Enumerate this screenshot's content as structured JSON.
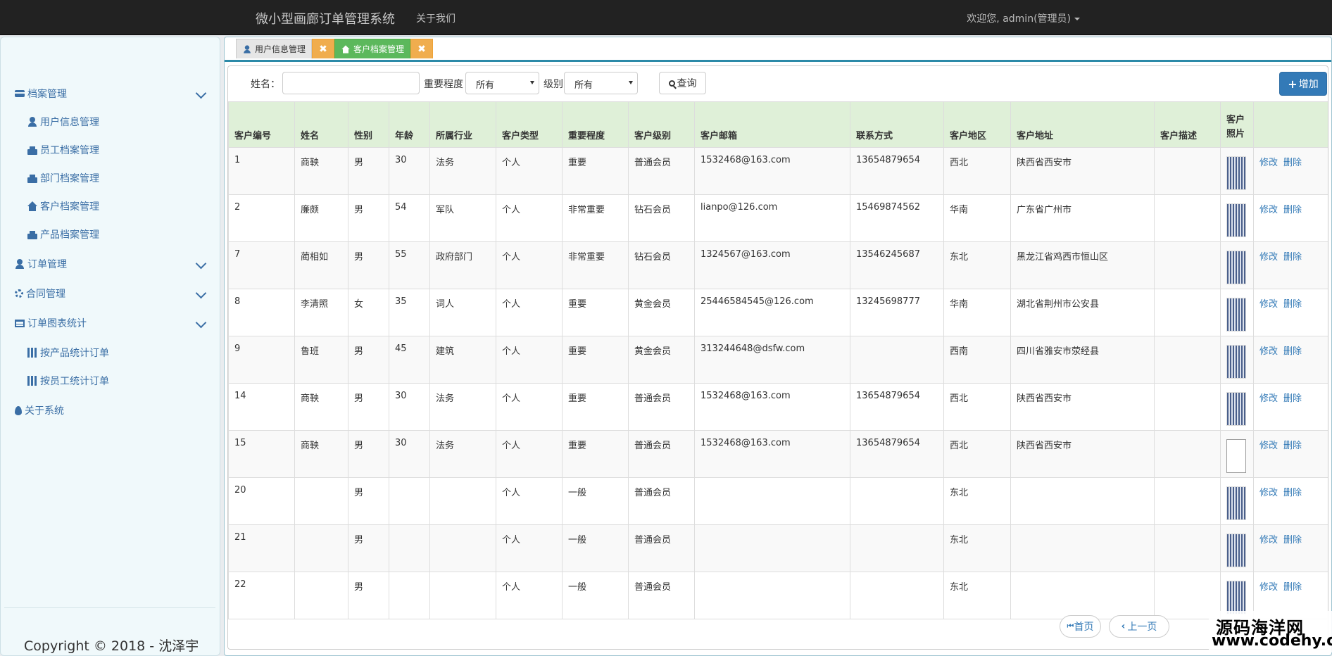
{
  "navbar": {
    "brand": "微小型画廊订单管理系统",
    "about": "关于我们",
    "welcome": "欢迎您, admin(管理员)"
  },
  "sidebar": {
    "groups": [
      {
        "label": "档案管理",
        "icon": "id-card-icon"
      },
      {
        "label": "订单管理",
        "icon": "user-icon"
      },
      {
        "label": "合同管理",
        "icon": "gear-icon"
      },
      {
        "label": "订单图表统计",
        "icon": "table-icon"
      }
    ],
    "items": [
      {
        "label": "用户信息管理",
        "icon": "user-icon"
      },
      {
        "label": "员工档案管理",
        "icon": "print-icon"
      },
      {
        "label": "部门档案管理",
        "icon": "print-icon"
      },
      {
        "label": "客户档案管理",
        "icon": "home-icon"
      },
      {
        "label": "产品档案管理",
        "icon": "print-icon"
      },
      {
        "label": "按产品统计订单",
        "icon": "bar-chart-icon"
      },
      {
        "label": "按员工统计订单",
        "icon": "bar-chart-icon"
      }
    ],
    "about": "关于系统",
    "copyright": "Copyright © 2018 - 沈泽宇"
  },
  "tabs": [
    {
      "label": "用户信息管理",
      "close": "✖"
    },
    {
      "label": "客户档案管理",
      "close": "✖"
    }
  ],
  "search": {
    "name_label": "姓名：",
    "name_value": "",
    "importance_label": "重要程度",
    "importance_value": "所有",
    "level_label": "级别",
    "level_value": "所有",
    "query_button": "查询",
    "add_button": "增加"
  },
  "table": {
    "headers": [
      "客户编号",
      "姓名",
      "性别",
      "年龄",
      "所属行业",
      "客户类型",
      "重要程度",
      "客户级别",
      "客户邮箱",
      "联系方式",
      "客户地区",
      "客户地址",
      "客户描述",
      "客户照片",
      ""
    ],
    "edit_label": "修改",
    "delete_label": "删除",
    "rows": [
      [
        "1",
        "商鞅",
        "男",
        "30",
        "法务",
        "个人",
        "重要",
        "普通会员",
        "1532468@163.com",
        "13654879654",
        "西北",
        "陕西省西安市",
        ""
      ],
      [
        "2",
        "廉颇",
        "男",
        "54",
        "军队",
        "个人",
        "非常重要",
        "钻石会员",
        "lianpo@126.com",
        "15469874562",
        "华南",
        "广东省广州市",
        ""
      ],
      [
        "7",
        "蔺相如",
        "男",
        "55",
        "政府部门",
        "个人",
        "非常重要",
        "钻石会员",
        "1324567@163.com",
        "13546245687",
        "东北",
        "黑龙江省鸡西市恒山区",
        ""
      ],
      [
        "8",
        "李清照",
        "女",
        "35",
        "词人",
        "个人",
        "重要",
        "黄金会员",
        "25446584545@126.com",
        "13245698777",
        "华南",
        "湖北省荆州市公安县",
        ""
      ],
      [
        "9",
        "鲁班",
        "男",
        "45",
        "建筑",
        "个人",
        "重要",
        "黄金会员",
        "313244648@dsfw.com",
        "",
        "西南",
        "四川省雅安市荥经县",
        ""
      ],
      [
        "14",
        "商鞅",
        "男",
        "30",
        "法务",
        "个人",
        "重要",
        "普通会员",
        "1532468@163.com",
        "13654879654",
        "西北",
        "陕西省西安市",
        ""
      ],
      [
        "15",
        "商鞅",
        "男",
        "30",
        "法务",
        "个人",
        "重要",
        "普通会员",
        "1532468@163.com",
        "13654879654",
        "西北",
        "陕西省西安市",
        ""
      ],
      [
        "20",
        "",
        "男",
        "",
        "",
        "个人",
        "一般",
        "普通会员",
        "",
        "",
        "东北",
        "",
        ""
      ],
      [
        "21",
        "",
        "男",
        "",
        "",
        "个人",
        "一般",
        "普通会员",
        "",
        "",
        "东北",
        "",
        ""
      ],
      [
        "22",
        "",
        "男",
        "",
        "",
        "个人",
        "一般",
        "普通会员",
        "",
        "",
        "东北",
        "",
        ""
      ]
    ]
  },
  "pager": {
    "first": "首页",
    "prev": "上一页"
  },
  "watermark": {
    "line1": "源码海洋网",
    "line2": "www.codehy.com"
  }
}
